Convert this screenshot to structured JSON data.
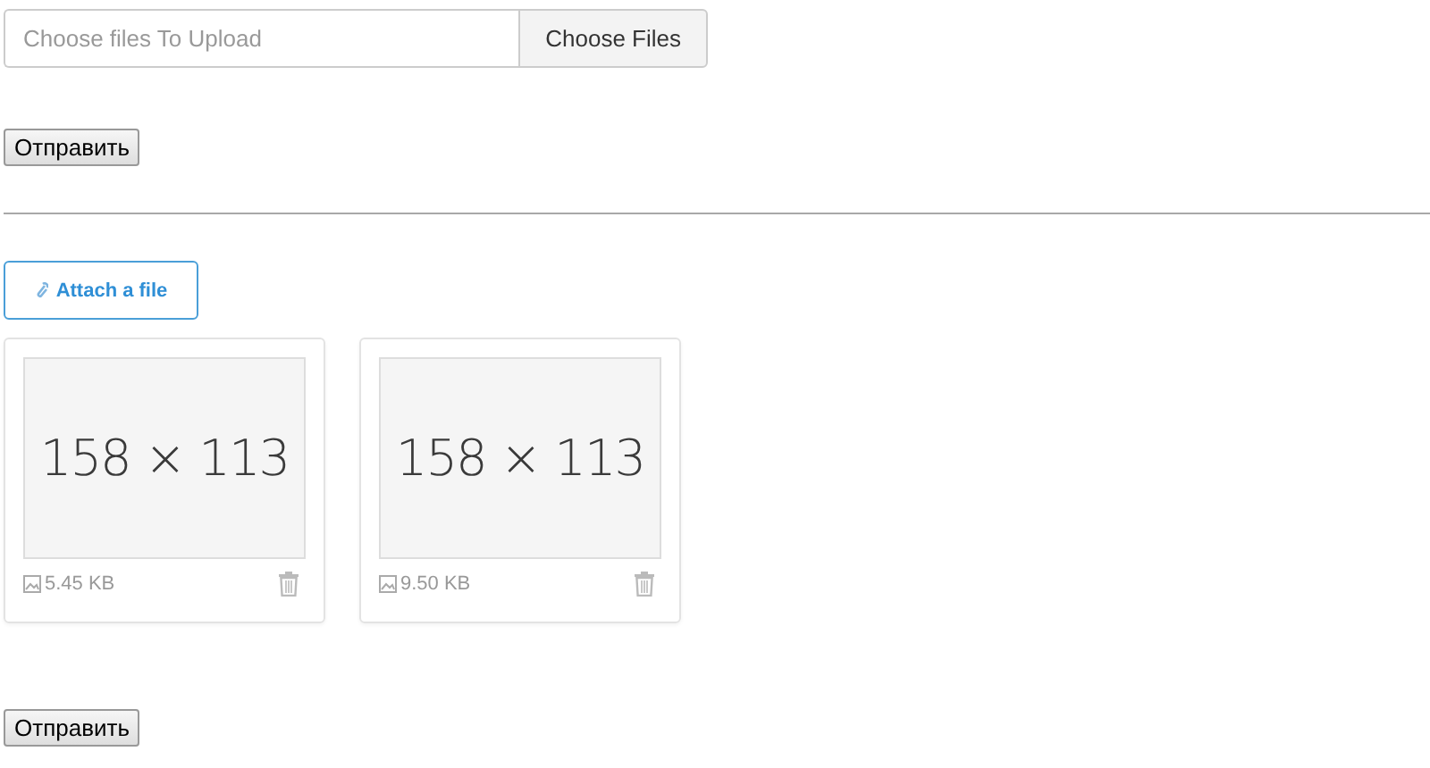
{
  "upload_field": {
    "placeholder": "Choose files To Upload",
    "button": "Choose Files"
  },
  "submit_top": "Отправить",
  "attach_button": "Attach a file",
  "files": [
    {
      "thumbnail": "158 × 113",
      "size": "5.45 KB"
    },
    {
      "thumbnail": "158 × 113",
      "size": "9.50 KB"
    }
  ],
  "submit_bottom": "Отправить"
}
